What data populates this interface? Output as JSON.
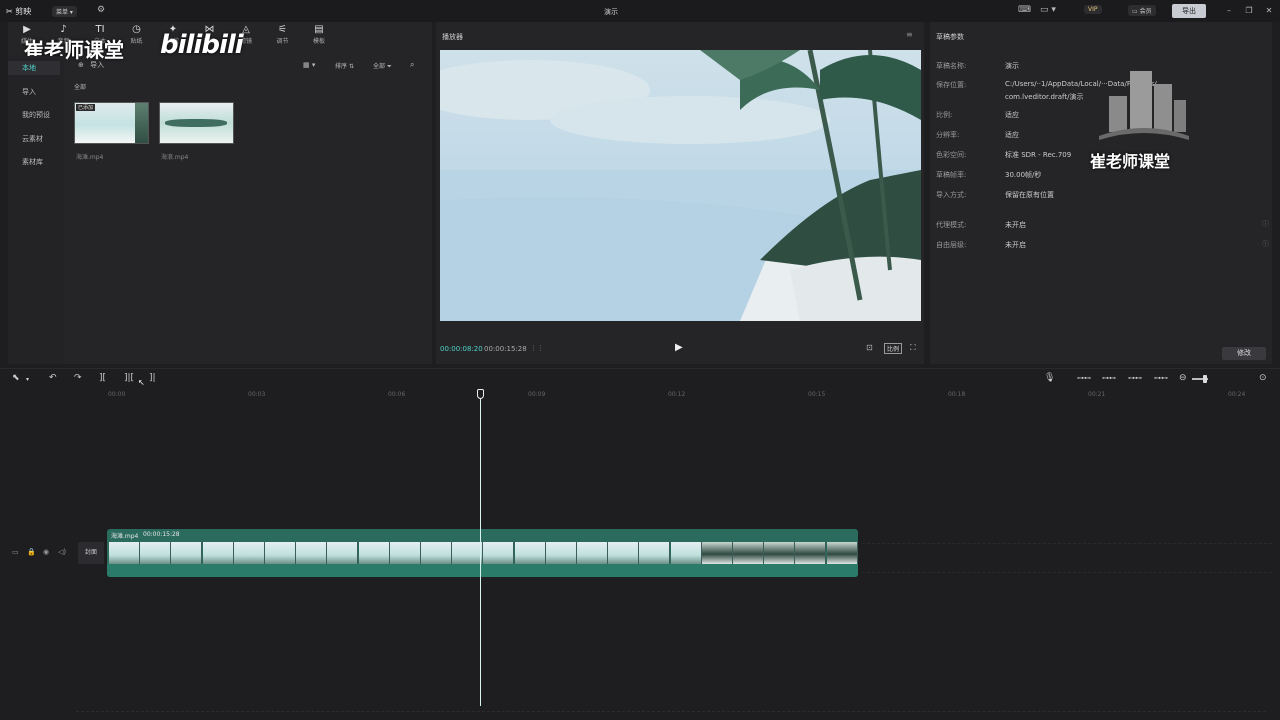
{
  "titlebar": {
    "app_name": "剪映",
    "menu_label": "菜单",
    "project_title": "演示",
    "vip_label": "VIP",
    "right_btn_1": "会员",
    "export_label": "导出"
  },
  "toolbar": {
    "items": [
      {
        "label": "媒体",
        "glyph": "▶"
      },
      {
        "label": "音频",
        "glyph": "♪"
      },
      {
        "label": "文本",
        "glyph": "TI"
      },
      {
        "label": "贴纸",
        "glyph": "◷"
      },
      {
        "label": "特效",
        "glyph": "✦"
      },
      {
        "label": "转场",
        "glyph": "⋈"
      },
      {
        "label": "滤镜",
        "glyph": "◬"
      },
      {
        "label": "调节",
        "glyph": "⚟"
      },
      {
        "label": "模板",
        "glyph": "▤"
      }
    ]
  },
  "watermark": {
    "channel": "崔老师课堂",
    "site": "bilibili",
    "logo_text": "崔老师课堂"
  },
  "media_sidebar": {
    "items": [
      "本地",
      "导入",
      "我的预设",
      "云素材",
      "素材库"
    ]
  },
  "media_panel": {
    "import_label": "导入",
    "sort_label": "排序",
    "filter_label": "全部",
    "section_label": "全部",
    "clips": [
      {
        "name": "海滩.mp4",
        "badge": "已添加"
      },
      {
        "name": "海浪.mp4",
        "badge": ""
      }
    ]
  },
  "player": {
    "title": "播放器",
    "current_time": "00:00:08:20",
    "total_time": "00:00:15:28",
    "ratio_label": "比例"
  },
  "params": {
    "title": "草稿参数",
    "rows": [
      {
        "label": "草稿名称:",
        "value": "演示"
      },
      {
        "label": "保存位置:",
        "value": "C:/Users/··1/AppData/Local/···Data/Projects/"
      },
      {
        "label": "",
        "value": "com.lveditor.draft/演示"
      },
      {
        "label": "比例:",
        "value": "适应"
      },
      {
        "label": "分辨率:",
        "value": "适应"
      },
      {
        "label": "色彩空间:",
        "value": "标准 SDR - Rec.709"
      },
      {
        "label": "草稿帧率:",
        "value": "30.00帧/秒"
      },
      {
        "label": "导入方式:",
        "value": "保留在原有位置"
      },
      {
        "label": "代理模式:",
        "value": "未开启"
      },
      {
        "label": "自由层级:",
        "value": "未开启"
      }
    ],
    "modify_button": "修改"
  },
  "timeline": {
    "ticks": [
      "00:00",
      "00:03",
      "00:06",
      "00:09",
      "00:12",
      "00:15",
      "00:18",
      "00:21",
      "00:24"
    ],
    "track_cover_label": "封面",
    "clip_name": "海滩.mp4",
    "clip_duration": "00:00:15:28",
    "playhead_fraction": 0.5478
  },
  "colors": {
    "accent": "#4fd3c8",
    "clip_green": "#2a6b5e",
    "panel": "#252528"
  }
}
